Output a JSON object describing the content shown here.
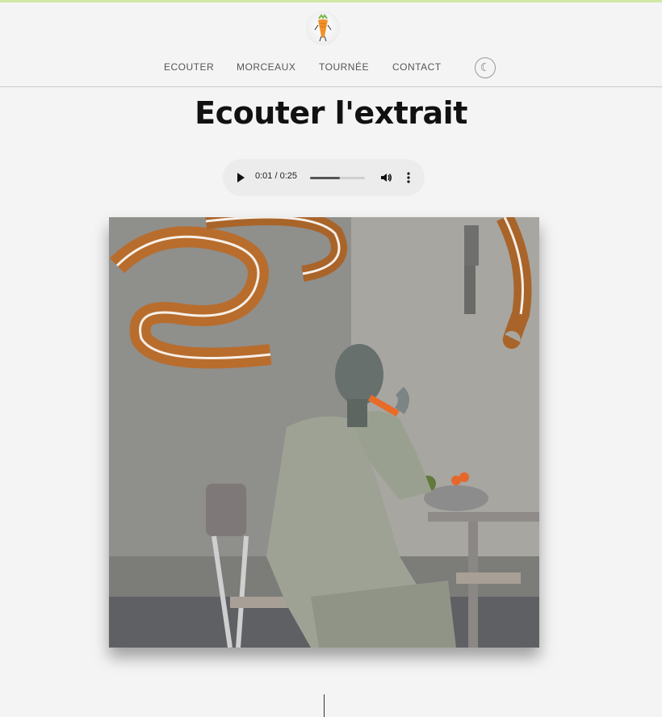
{
  "nav": {
    "items": [
      {
        "label": "ECOUTER"
      },
      {
        "label": "MORCEAUX"
      },
      {
        "label": "TOURNÉE"
      },
      {
        "label": "CONTACT"
      }
    ],
    "theme_toggle_icon": "moon-icon"
  },
  "main": {
    "title": "Ecouter l'extrait",
    "audio": {
      "time": "0:01 / 0:25",
      "progress": 0.55,
      "play_icon": "play-icon",
      "volume_icon": "volume-icon",
      "menu_icon": "more-vertical-icon"
    },
    "photo": {
      "description": "tattooed-man-eating-carrot"
    }
  },
  "colors": {
    "accent_top": "#cfe8a6",
    "background": "#f4f4f4",
    "text": "#111111"
  }
}
